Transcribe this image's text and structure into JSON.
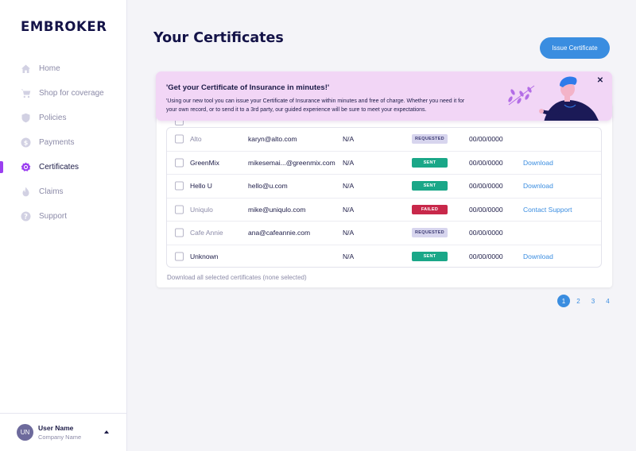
{
  "sidebar": {
    "logo": "EMBROKER",
    "items": [
      {
        "label": "Home",
        "icon": "home-icon"
      },
      {
        "label": "Shop for coverage",
        "icon": "cart-icon"
      },
      {
        "label": "Policies",
        "icon": "shield-icon"
      },
      {
        "label": "Payments",
        "icon": "dollar-icon"
      },
      {
        "label": "Certificates",
        "icon": "certificate-icon",
        "active": true
      },
      {
        "label": "Claims",
        "icon": "flame-icon"
      },
      {
        "label": "Support",
        "icon": "question-icon"
      }
    ],
    "user": {
      "initials": "UN",
      "name": "User Name",
      "company": "Company Name"
    }
  },
  "main": {
    "title": "Your Certificates",
    "issue_button": "Issue Certificate",
    "banner": {
      "title": "'Get your Certificate of Insurance in minutes!'",
      "text": "'Using our new tool you can issue your Certificate of Insurance within minutes and free of charge. Whether you need it for your own record, or to send it to a 3rd party, our guided experience will be sure to meet your expectations.",
      "close": "✕"
    },
    "rows": [
      {
        "name": "Alto",
        "email": "karyn@alto.com",
        "na": "N/A",
        "status": "REQUESTED",
        "date": "00/00/0000",
        "action": ""
      },
      {
        "name": "GreenMix",
        "email": "mikesemai...@greenmix.com",
        "na": "N/A",
        "status": "SENT",
        "date": "00/00/0000",
        "action": "Download"
      },
      {
        "name": "Hello U",
        "email": "hello@u.com",
        "na": "N/A",
        "status": "SENT",
        "date": "00/00/0000",
        "action": "Download"
      },
      {
        "name": "Uniqulo",
        "email": "mike@uniqulo.com",
        "na": "N/A",
        "status": "FAILED",
        "date": "00/00/0000",
        "action": "Contact Support"
      },
      {
        "name": "Cafe Annie",
        "email": "ana@cafeannie.com",
        "na": "N/A",
        "status": "REQUESTED",
        "date": "00/00/0000",
        "action": ""
      },
      {
        "name": "Unknown",
        "email": "",
        "na": "N/A",
        "status": "SENT",
        "date": "00/00/0000",
        "action": "Download"
      }
    ],
    "download_all": "Download all selected certificates (none selected)",
    "pagination": [
      "1",
      "2",
      "3",
      "4"
    ],
    "current_page": "1"
  },
  "colors": {
    "accent": "#3a8de0",
    "active_nav": "#9b3ff0",
    "banner_bg": "#f2d6f6",
    "sent": "#1aa788",
    "failed": "#c8284a",
    "requested": "#d7d5ee"
  }
}
